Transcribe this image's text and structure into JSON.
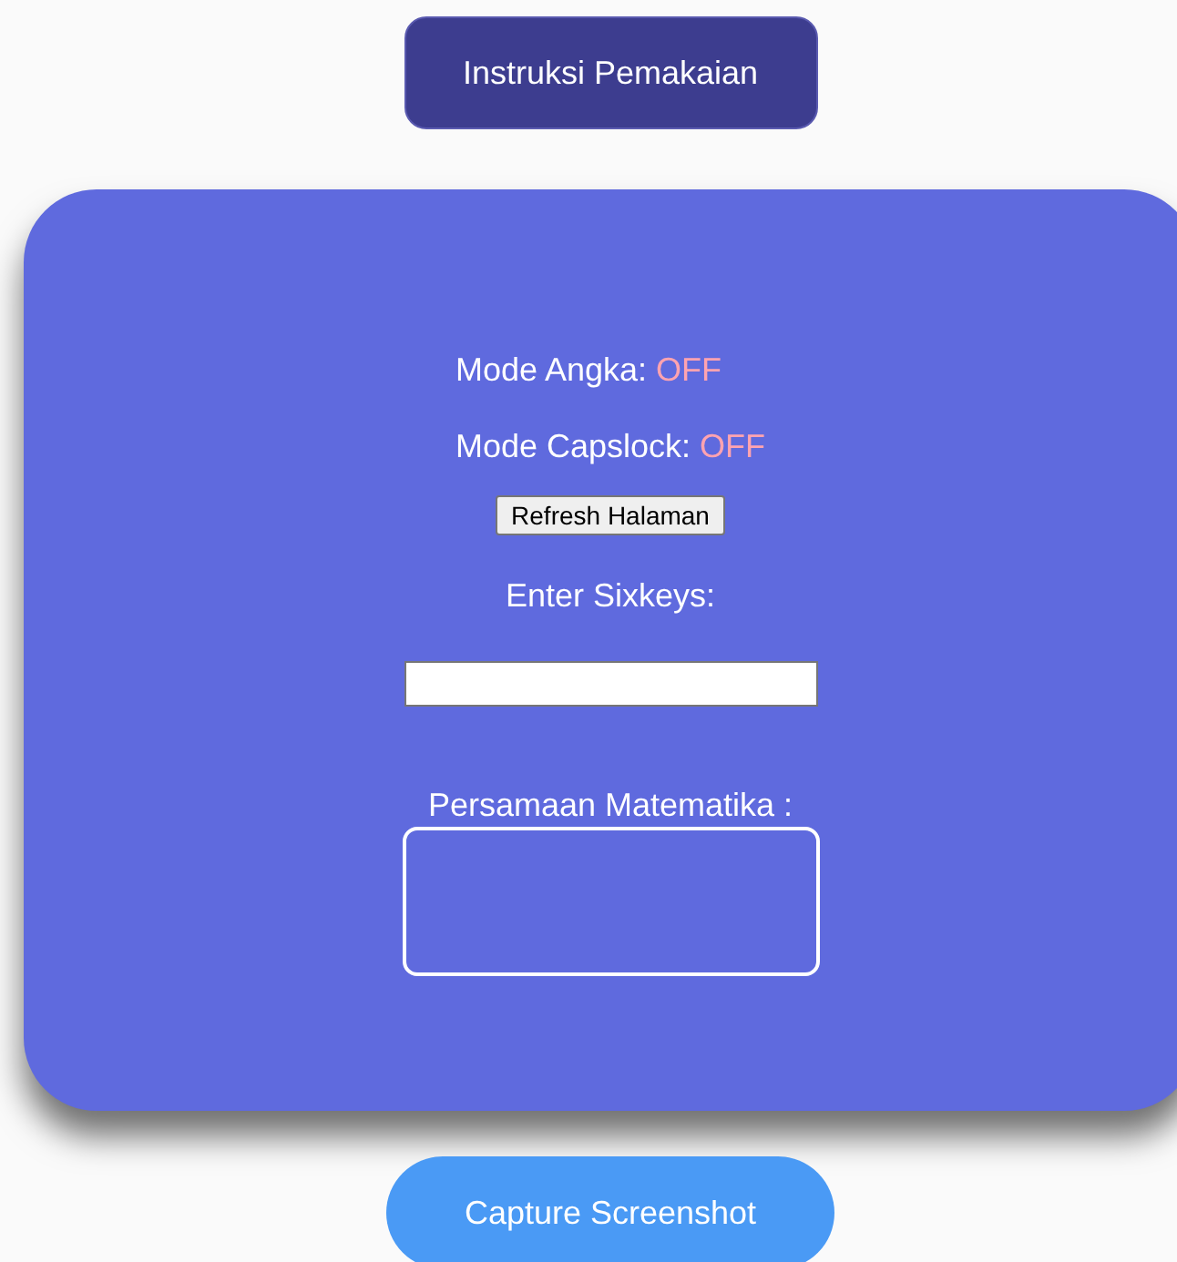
{
  "instructions_button": {
    "label": "Instruksi Pemakaian"
  },
  "modes": [
    {
      "label": "Mode Angka:",
      "value": "OFF",
      "on": false
    },
    {
      "label": "Mode Capslock:",
      "value": "OFF",
      "on": false
    }
  ],
  "refresh_button": {
    "label": "Refresh Halaman"
  },
  "sixkeys": {
    "label": "Enter Sixkeys:"
  },
  "equation": {
    "label": "Persamaan Matematika :"
  },
  "capture_button": {
    "label": "Capture Screenshot"
  }
}
